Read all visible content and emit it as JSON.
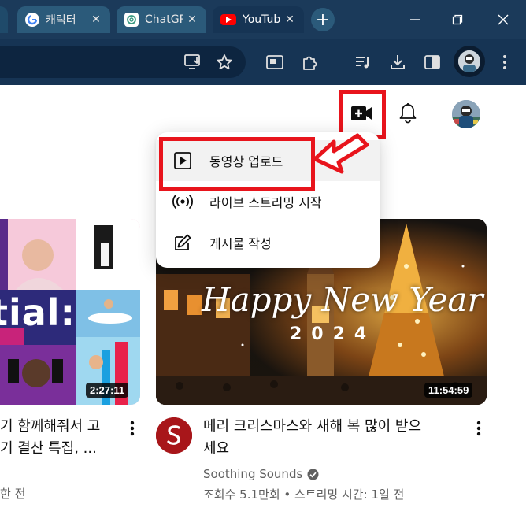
{
  "browser": {
    "tabs": [
      {
        "title": "캐릭터",
        "favicon": "google-icon"
      },
      {
        "title": "ChatGPT",
        "favicon": "chatgpt-icon"
      },
      {
        "title": "YouTube",
        "favicon": "youtube-icon",
        "active": true
      }
    ],
    "new_tab_label": "+"
  },
  "menu": {
    "items": [
      {
        "label": "동영상 업로드",
        "icon": "play-square-icon"
      },
      {
        "label": "라이브 스트리밍 시작",
        "icon": "live-broadcast-icon"
      },
      {
        "label": "게시물 작성",
        "icon": "edit-post-icon"
      }
    ]
  },
  "videos": [
    {
      "title_line1": "기 함께해줘서 고",
      "title_line2": "기 결산 특집, ...",
      "meta": "한 전",
      "duration": "2:27:11",
      "thumb_text": "tial:"
    },
    {
      "title_line1": "메리 크리스마스와 새해 복 많이 받으",
      "title_line2": "세요",
      "channel": "Soothing Sounds",
      "verified": true,
      "meta": "조회수 5.1만회 • 스트리밍 시간: 1일 전",
      "duration": "11:54:59",
      "thumb_title": "Happy New Year",
      "thumb_year": "2024"
    }
  ],
  "colors": {
    "highlight": "#e8141c",
    "browser_frame": "#1b3a5a",
    "toolbar": "#163454",
    "youtube_red": "#ff0000"
  }
}
